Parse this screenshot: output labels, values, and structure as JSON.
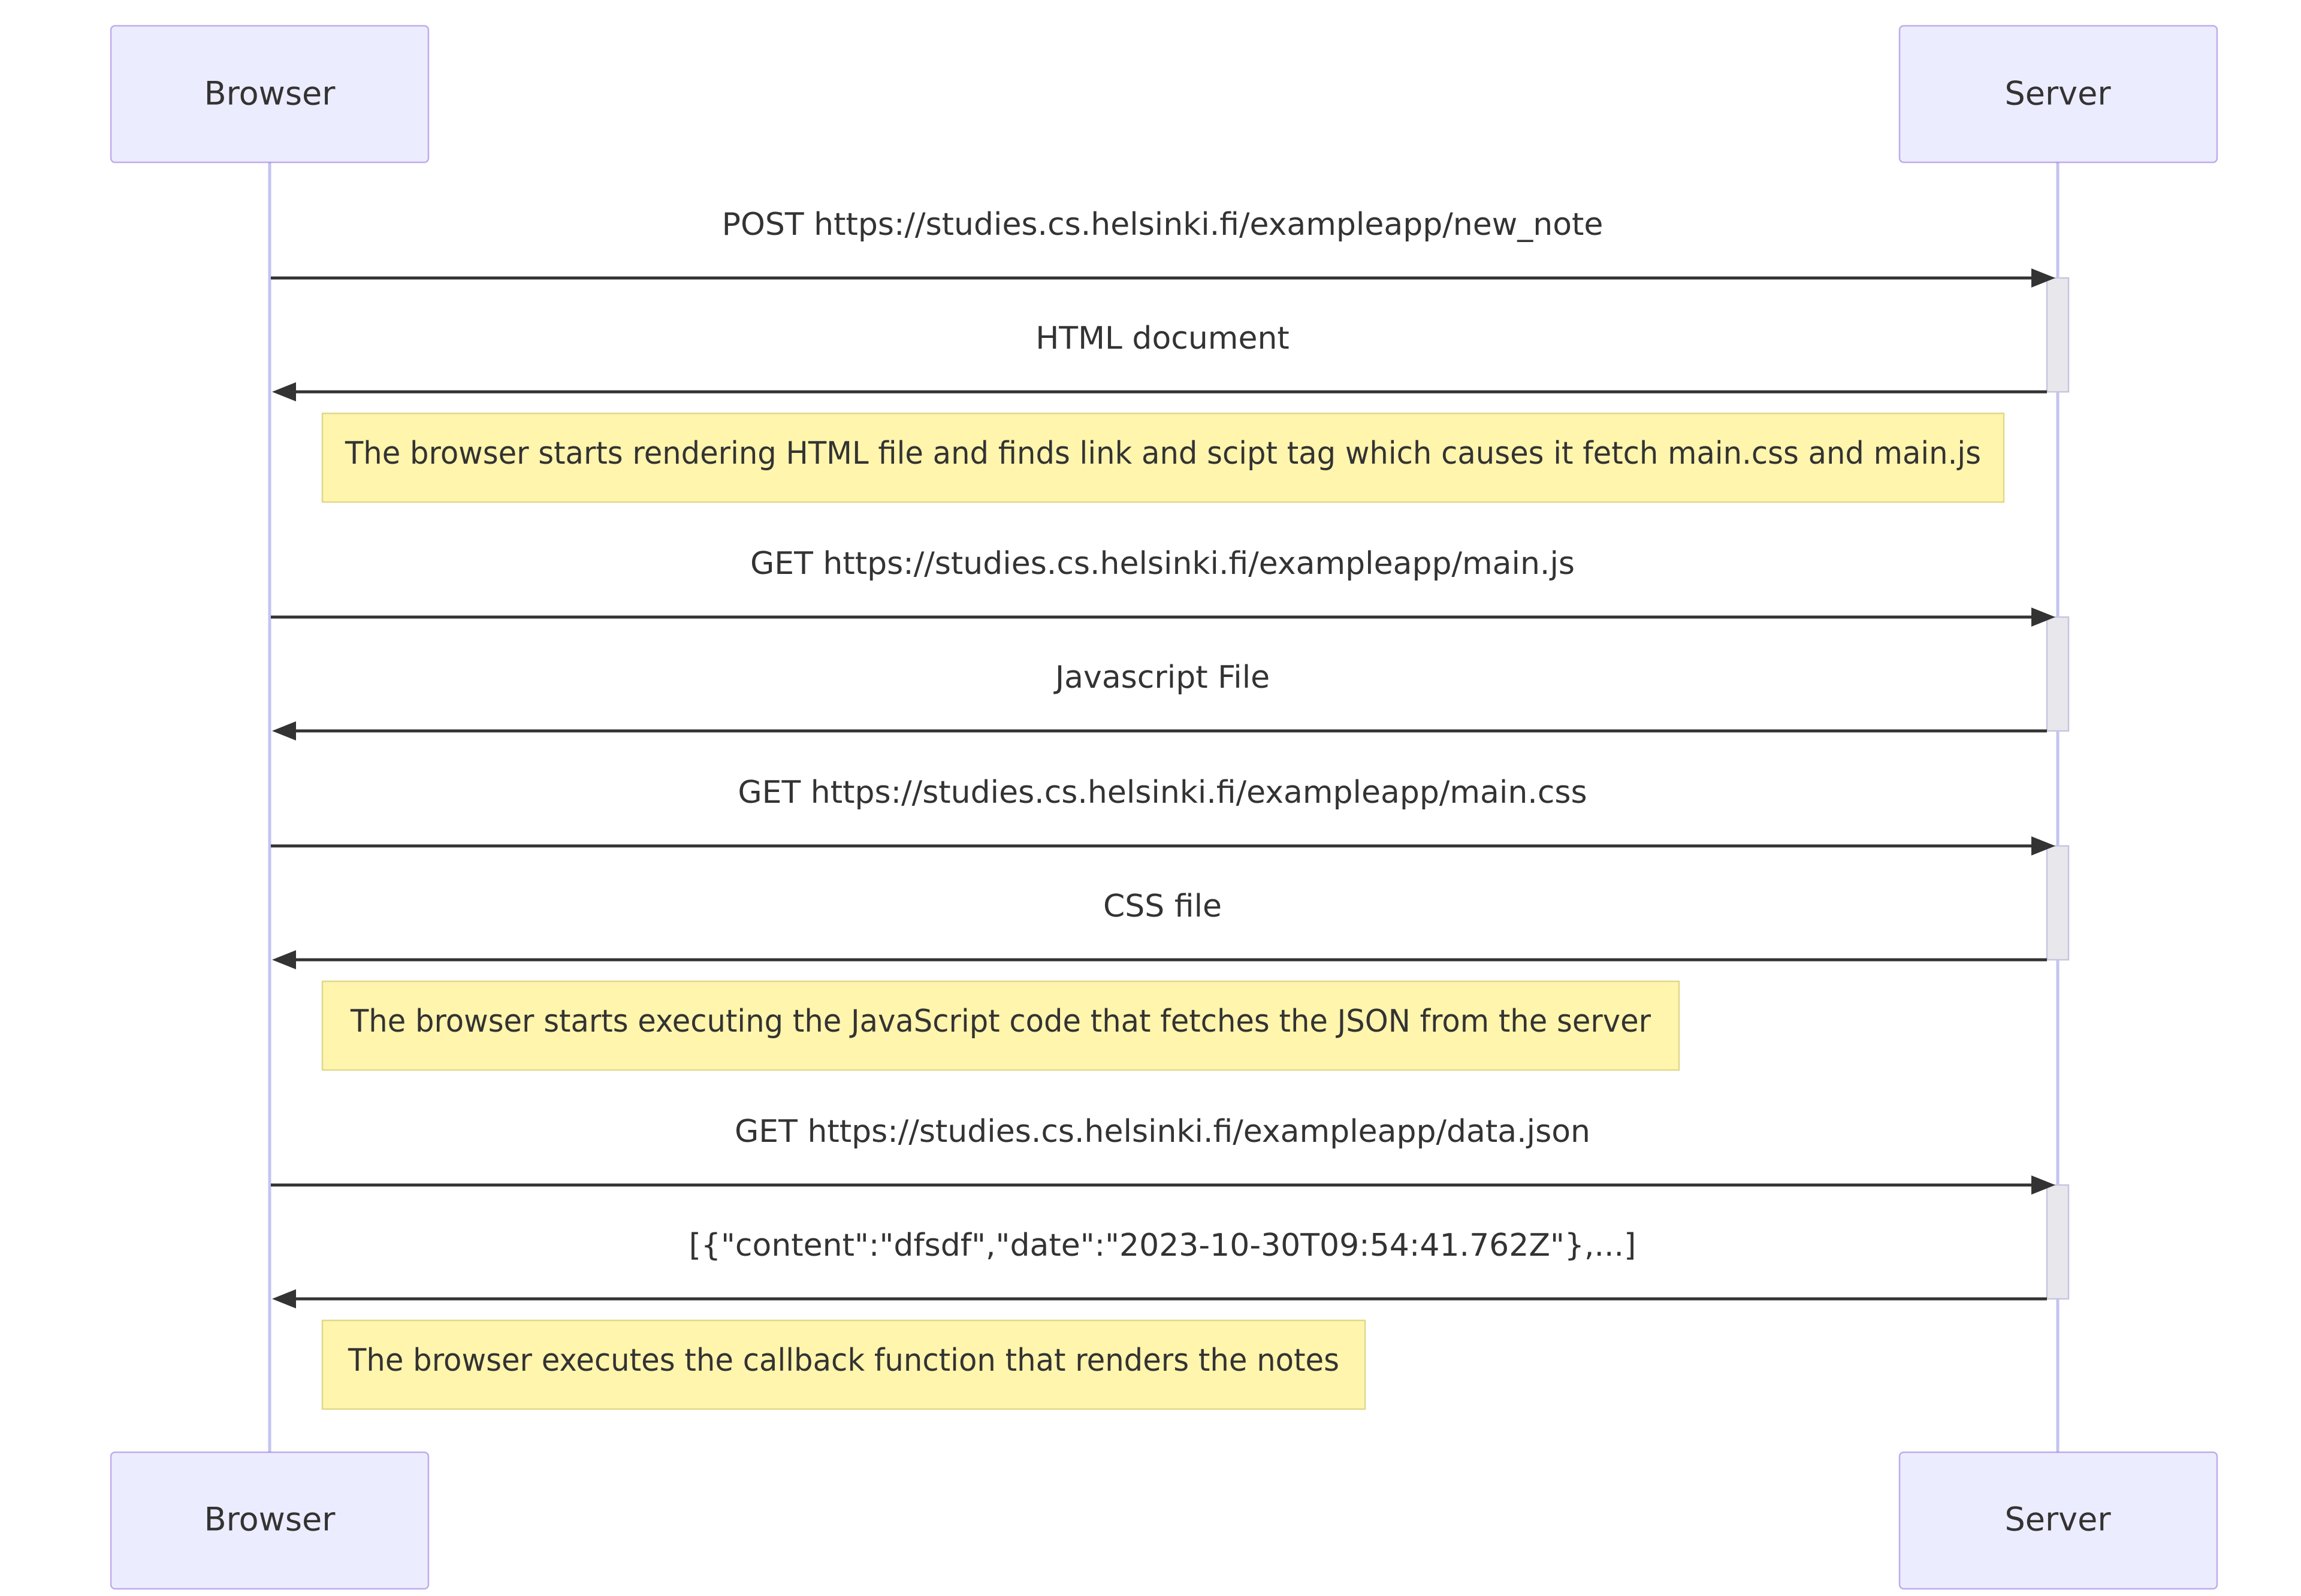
{
  "participants": {
    "browser": "Browser",
    "server": "Server"
  },
  "messages": [
    {
      "direction": "request",
      "text": "POST https://studies.cs.helsinki.fi/exampleapp/new_note"
    },
    {
      "direction": "response",
      "text": "HTML document"
    },
    {
      "direction": "request",
      "text": "GET https://studies.cs.helsinki.fi/exampleapp/main.js"
    },
    {
      "direction": "response",
      "text": "Javascript File"
    },
    {
      "direction": "request",
      "text": "GET https://studies.cs.helsinki.fi/exampleapp/main.css"
    },
    {
      "direction": "response",
      "text": "CSS file"
    },
    {
      "direction": "request",
      "text": "GET https://studies.cs.helsinki.fi/exampleapp/data.json"
    },
    {
      "direction": "response",
      "text": "[{\"content\":\"dfsdf\",\"date\":\"2023-10-30T09:54:41.762Z\"},...]"
    }
  ],
  "notes": [
    {
      "text": "The browser starts rendering HTML file and finds link and scipt tag which causes it fetch main.css and main.js"
    },
    {
      "text": "The browser starts executing the JavaScript code that fetches the JSON from the server"
    },
    {
      "text": "The browser executes the callback function that renders the notes"
    }
  ],
  "colors": {
    "actor_fill": "#ececff",
    "lifeline": "#c3c3f2",
    "arrow": "#333333",
    "note_fill": "#fff5ad",
    "activation_fill": "#e8e8ec"
  }
}
